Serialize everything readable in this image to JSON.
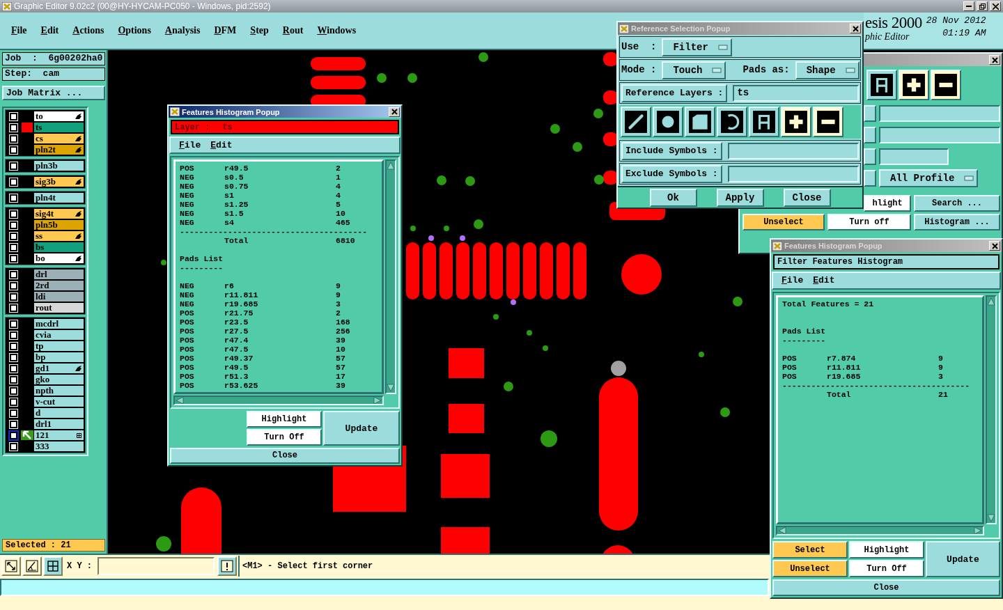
{
  "title_bar": {
    "title": "Graphic Editor 9.02c2 (00@HY-HYCAM-PC050 - Windows, pid:2592)"
  },
  "menu": [
    "File",
    "Edit",
    "Actions",
    "Options",
    "Analysis",
    "DFM",
    "Step",
    "Rout",
    "Windows"
  ],
  "branding": {
    "product": "esis 2000",
    "subtitle": "phic Editor",
    "date": "28 Nov 2012",
    "time": "01:19 AM"
  },
  "job": {
    "job": "Job  :  6g00202ha0",
    "step": "Step:  cam",
    "matrix_button": "Job Matrix ..."
  },
  "layer_groups": [
    [
      {
        "name": "to",
        "color": "#ffffff",
        "checked": false,
        "displayed": false,
        "work": false,
        "kind": "hand"
      },
      {
        "name": "ts",
        "color": "#13a07c",
        "checked": false,
        "displayed": true,
        "work": false,
        "kind": "plain"
      },
      {
        "name": "cs",
        "color": "#ffc850",
        "checked": false,
        "displayed": false,
        "work": false,
        "kind": "hand"
      },
      {
        "name": "pln2t",
        "color": "#dca400",
        "checked": false,
        "displayed": false,
        "work": false,
        "kind": "hand"
      }
    ],
    [
      {
        "name": "pln3b",
        "color": "#9cdcdc",
        "checked": false,
        "displayed": false,
        "work": false,
        "kind": "plain"
      }
    ],
    [
      {
        "name": "sig3b",
        "color": "#ffc850",
        "checked": false,
        "displayed": false,
        "work": false,
        "kind": "hand"
      }
    ],
    [
      {
        "name": "pln4t",
        "color": "#9cdcdc",
        "checked": false,
        "displayed": false,
        "work": false,
        "kind": "plain"
      }
    ],
    [
      {
        "name": "sig4t",
        "color": "#ffc850",
        "checked": false,
        "displayed": false,
        "work": false,
        "kind": "hand"
      },
      {
        "name": "pln5b",
        "color": "#dca400",
        "checked": false,
        "displayed": false,
        "work": false,
        "kind": "plain"
      },
      {
        "name": "ss",
        "color": "#ffc850",
        "checked": false,
        "displayed": false,
        "work": false,
        "kind": "hand"
      },
      {
        "name": "bs",
        "color": "#13a07c",
        "checked": false,
        "displayed": false,
        "work": false,
        "kind": "plain"
      },
      {
        "name": "bo",
        "color": "#ffffff",
        "checked": false,
        "displayed": false,
        "work": false,
        "kind": "hand"
      }
    ],
    [
      {
        "name": "drl",
        "color": "#9cb0b8",
        "checked": false,
        "displayed": false,
        "work": false,
        "kind": "plain"
      },
      {
        "name": "2rd",
        "color": "#9cb0b8",
        "checked": false,
        "displayed": false,
        "work": false,
        "kind": "plain"
      },
      {
        "name": "ldi",
        "color": "#9cb0b8",
        "checked": false,
        "displayed": false,
        "work": false,
        "kind": "plain"
      },
      {
        "name": "rout",
        "color": "#d8d8d8",
        "checked": false,
        "displayed": false,
        "work": false,
        "kind": "plain"
      }
    ],
    [
      {
        "name": "mcdrl",
        "color": "#9cdcdc",
        "checked": false,
        "displayed": false,
        "work": false,
        "kind": "plain"
      },
      {
        "name": "cvia",
        "color": "#9cdcdc",
        "checked": false,
        "displayed": false,
        "work": false,
        "kind": "plain"
      },
      {
        "name": "tp",
        "color": "#9cdcdc",
        "checked": false,
        "displayed": false,
        "work": false,
        "kind": "plain"
      },
      {
        "name": "bp",
        "color": "#9cdcdc",
        "checked": false,
        "displayed": false,
        "work": false,
        "kind": "plain"
      },
      {
        "name": "gd1",
        "color": "#9cdcdc",
        "checked": false,
        "displayed": false,
        "work": false,
        "kind": "hand"
      },
      {
        "name": "gko",
        "color": "#9cdcdc",
        "checked": false,
        "displayed": false,
        "work": false,
        "kind": "plain"
      },
      {
        "name": "npth",
        "color": "#9cdcdc",
        "checked": false,
        "displayed": false,
        "work": false,
        "kind": "plain"
      },
      {
        "name": "v-cut",
        "color": "#9cdcdc",
        "checked": false,
        "displayed": false,
        "work": false,
        "kind": "plain"
      },
      {
        "name": "d",
        "color": "#9cdcdc",
        "checked": false,
        "displayed": false,
        "work": false,
        "kind": "plain"
      },
      {
        "name": "drl1",
        "color": "#9cdcdc",
        "checked": false,
        "displayed": false,
        "work": false,
        "kind": "plain"
      },
      {
        "name": "121",
        "color": "#9cdcdc",
        "checked": false,
        "displayed": false,
        "work": true,
        "kind": "grid"
      },
      {
        "name": "333",
        "color": "#9cdcdc",
        "checked": false,
        "displayed": false,
        "work": false,
        "kind": "plain"
      }
    ]
  ],
  "selected": "Selected : 21",
  "histogram_popup": {
    "title": "Features Histogram Popup",
    "active": true,
    "header_label": "Layer :",
    "header_value": "ts",
    "menu": [
      "File",
      "Edit"
    ],
    "lines": [
      {
        "kind": "row",
        "polarity": "POS",
        "symbol": "r49.5",
        "count": "2"
      },
      {
        "kind": "row",
        "polarity": "NEG",
        "symbol": "s0.5",
        "count": "1"
      },
      {
        "kind": "row",
        "polarity": "NEG",
        "symbol": "s0.75",
        "count": "4"
      },
      {
        "kind": "row",
        "polarity": "NEG",
        "symbol": "s1",
        "count": "4"
      },
      {
        "kind": "row",
        "polarity": "NEG",
        "symbol": "s1.25",
        "count": "5"
      },
      {
        "kind": "row",
        "polarity": "NEG",
        "symbol": "s1.5",
        "count": "10"
      },
      {
        "kind": "row",
        "polarity": "NEG",
        "symbol": "s4",
        "count": "465"
      },
      {
        "kind": "rule",
        "text": "---------------------------------------"
      },
      {
        "kind": "total",
        "label": "Total",
        "count": "6810"
      },
      {
        "kind": "blank"
      },
      {
        "kind": "heading",
        "text": "Pads List"
      },
      {
        "kind": "rule",
        "text": "---------"
      },
      {
        "kind": "blank"
      },
      {
        "kind": "row",
        "polarity": "NEG",
        "symbol": "r6",
        "count": "9"
      },
      {
        "kind": "row",
        "polarity": "NEG",
        "symbol": "r11.811",
        "count": "9"
      },
      {
        "kind": "row",
        "polarity": "NEG",
        "symbol": "r19.685",
        "count": "3"
      },
      {
        "kind": "row",
        "polarity": "POS",
        "symbol": "r21.75",
        "count": "2"
      },
      {
        "kind": "row",
        "polarity": "POS",
        "symbol": "r23.5",
        "count": "168"
      },
      {
        "kind": "row",
        "polarity": "POS",
        "symbol": "r27.5",
        "count": "256"
      },
      {
        "kind": "row",
        "polarity": "POS",
        "symbol": "r47.4",
        "count": "39"
      },
      {
        "kind": "row",
        "polarity": "POS",
        "symbol": "r47.5",
        "count": "10"
      },
      {
        "kind": "row",
        "polarity": "POS",
        "symbol": "r49.37",
        "count": "57"
      },
      {
        "kind": "row",
        "polarity": "POS",
        "symbol": "r49.5",
        "count": "57"
      },
      {
        "kind": "row",
        "polarity": "POS",
        "symbol": "r51.3",
        "count": "17"
      },
      {
        "kind": "row",
        "polarity": "POS",
        "symbol": "r53.625",
        "count": "39"
      }
    ],
    "buttons": [
      {
        "label": "Highlight",
        "kind": "white"
      },
      {
        "label": "Turn Off",
        "kind": "white"
      }
    ],
    "update": "Update",
    "close": "Close"
  },
  "reference_popup": {
    "title": "Reference Selection Popup",
    "use_label": "Use  :",
    "use_value": "Filter",
    "mode_label": "Mode :",
    "mode_value": "Touch",
    "pads_label": "Pads as:",
    "pads_value": "Shape",
    "layers_button": "Reference Layers :",
    "layers_value": "ts",
    "tools": [
      {
        "kind": "line",
        "on": false
      },
      {
        "kind": "circle",
        "on": false
      },
      {
        "kind": "surface",
        "on": false
      },
      {
        "kind": "arc",
        "on": false
      },
      {
        "kind": "text",
        "on": false
      },
      {
        "kind": "plus",
        "on": true
      },
      {
        "kind": "minus",
        "on": true
      }
    ],
    "include_button": "Include Symbols :",
    "exclude_button": "Exclude Symbols :",
    "buttons": [
      "Ok",
      "Apply",
      "Close"
    ]
  },
  "filter_panel": {
    "tools": [
      {
        "kind": "text",
        "on": false
      },
      {
        "kind": "plus",
        "on": true
      },
      {
        "kind": "minus",
        "on": true
      }
    ],
    "profile": "All Profile",
    "buttons": [
      {
        "label": "hlight",
        "kind": "white"
      },
      {
        "label": "Search ...",
        "kind": "plain"
      },
      {
        "label": "Unselect",
        "kind": "orange"
      },
      {
        "label": "Turn off",
        "kind": "white"
      },
      {
        "label": "Histogram ...",
        "kind": "plain"
      }
    ]
  },
  "filter_histogram_popup": {
    "title": "Features Histogram Popup",
    "active": false,
    "header": "Filter Features Histogram",
    "menu": [
      "File",
      "Edit"
    ],
    "lines": [
      {
        "kind": "heading",
        "text": "Total Features = 21"
      },
      {
        "kind": "blank"
      },
      {
        "kind": "blank"
      },
      {
        "kind": "heading",
        "text": "Pads List"
      },
      {
        "kind": "rule",
        "text": "---------"
      },
      {
        "kind": "blank"
      },
      {
        "kind": "row",
        "polarity": "POS",
        "symbol": "r7.874",
        "count": "9"
      },
      {
        "kind": "row",
        "polarity": "POS",
        "symbol": "r11.811",
        "count": "9"
      },
      {
        "kind": "row",
        "polarity": "POS",
        "symbol": "r19.685",
        "count": "3"
      },
      {
        "kind": "rule",
        "text": "---------------------------------------"
      },
      {
        "kind": "total",
        "label": "Total",
        "count": "21"
      }
    ],
    "buttons": [
      {
        "label": "Select",
        "kind": "orange"
      },
      {
        "label": "Highlight",
        "kind": "white"
      },
      {
        "label": "Unselect",
        "kind": "orange"
      },
      {
        "label": "Turn Off",
        "kind": "white"
      }
    ],
    "update": "Update",
    "close": "Close"
  },
  "status_bar": {
    "xy_label": "X Y :",
    "message": "<M1> - Select first corner"
  }
}
